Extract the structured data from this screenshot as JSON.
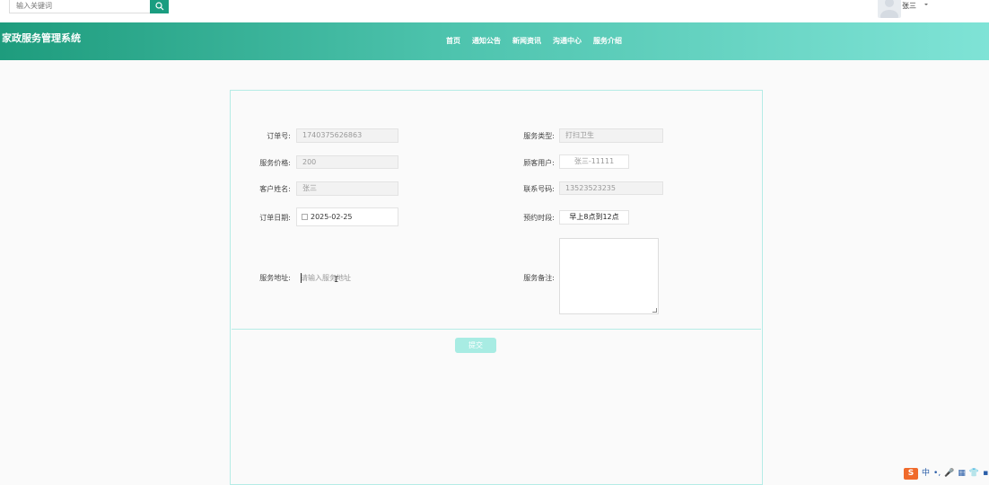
{
  "search": {
    "placeholder": "输入关键词"
  },
  "user": {
    "name": "张三"
  },
  "header": {
    "brand": "家政服务管理系统",
    "nav": [
      "首页",
      "通知公告",
      "新闻资讯",
      "沟通中心",
      "服务介绍"
    ]
  },
  "form": {
    "order_no_label": "订单号:",
    "order_no": "1740375626863",
    "service_type_label": "服务类型:",
    "service_type": "打扫卫生",
    "price_label": "服务价格:",
    "price": "200",
    "customer_user_label": "顾客用户:",
    "customer_user": "张三-11111",
    "customer_name_label": "客户姓名:",
    "customer_name": "张三",
    "phone_label": "联系号码:",
    "phone": "13523523235",
    "order_date_label": "订单日期:",
    "order_date": "2025-02-25",
    "slot_label": "预约时段:",
    "slot": "早上8点到12点",
    "address_label": "服务地址:",
    "address_placeholder": "请输入服务地址",
    "remark_label": "服务备注:",
    "submit": "提交"
  },
  "tray": {
    "logo": "S",
    "items": [
      "中",
      "•,",
      "🎤",
      "▦",
      "👕",
      "▪"
    ]
  }
}
